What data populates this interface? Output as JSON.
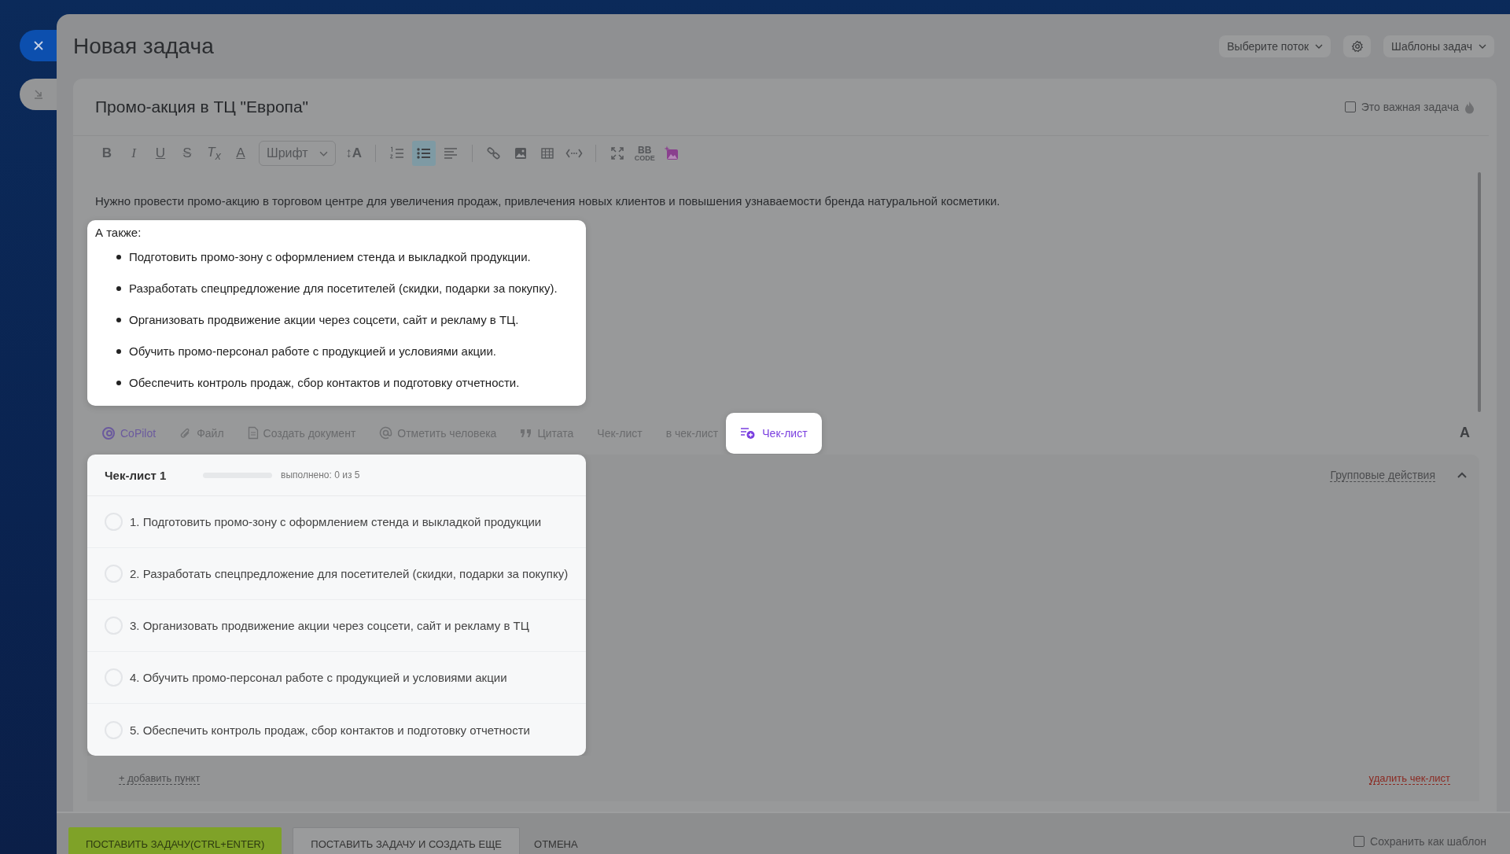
{
  "header": {
    "title": "Новая задача",
    "flow_select": "Выберите поток",
    "templates_select": "Шаблоны задач"
  },
  "task": {
    "title": "Промо-акция в ТЦ \"Европа\"",
    "important": {
      "label": "Это важная задача",
      "checked": false
    }
  },
  "toolbar": {
    "format_buttons": [
      {
        "text": "B"
      },
      {
        "text": "I"
      },
      {
        "text": "U"
      },
      {
        "text": "S"
      },
      {
        "text": "T$_{x}$"
      },
      {
        "text": "A"
      }
    ],
    "font_select": "Шрифт",
    "size_button": "↕A",
    "list_buttons": [
      {
        "selected": false
      },
      {
        "selected": true
      },
      {
        "selected": false
      }
    ],
    "bbcode": {
      "text": "BB",
      "subtext": "CODE"
    }
  },
  "description": {
    "text": "Нужно провести промо-акцию в торговом центре для увеличения продаж, привлечения новых клиентов и повышения узнаваемости бренда натуральной косметики.",
    "list_title": "А также:",
    "list_items": [
      "Подготовить промо-зону с оформлением стенда и выкладкой продукции.",
      "Разработать спецпредложение для посетителей (скидки, подарки за покупку).",
      "Организовать продвижение акции через соцсети, сайт и рекламу в ТЦ.",
      "Обучить промо-персонал работе с продукцией и условиями акции.",
      "Обеспечить контроль продаж, сбор контактов и подготовку отчетности."
    ]
  },
  "attachments": [
    {
      "kind": "copilot",
      "label": "CoPilot"
    },
    {
      "kind": "file",
      "label": "Файл"
    },
    {
      "kind": "document",
      "label": "Создать документ"
    },
    {
      "kind": "mention",
      "label": "Отметить человека"
    },
    {
      "kind": "quote",
      "label": "Цитата"
    },
    {
      "kind": "plain",
      "label": "Чек-лист"
    },
    {
      "kind": "plain",
      "label": "в чек-лист"
    },
    {
      "kind": "checklist",
      "label": "Чек-лист"
    }
  ],
  "text_style_button": "A",
  "checklist": {
    "title": "Чек-лист 1",
    "level": 0,
    "progress": "выполнено: 0 из 5",
    "group_actions": "Групповые действия",
    "expanded": true,
    "items": [
      {
        "text": "1. Подготовить промо-зону с оформлением стенда и выкладкой продукции",
        "checked": false
      },
      {
        "text": "2. Разработать спецпредложение для посетителей (скидки, подарки за покупку)",
        "checked": false
      },
      {
        "text": "3. Организовать продвижение акции через соцсети, сайт и рекламу в ТЦ",
        "checked": false
      },
      {
        "text": "4. Обучить промо-персонал работе с продукцией и условиями акции",
        "checked": false
      },
      {
        "text": "5. Обеспечить контроль продаж, сбор контактов и подготовку отчетности",
        "checked": false
      }
    ],
    "add_item": "+ добавить пункт",
    "delete": "удалить чек-лист"
  },
  "footer": {
    "buttons": [
      {
        "kind": "primary",
        "label": "ПОСТАВИТЬ ЗАДАЧУ(CTRL+ENTER)"
      },
      {
        "kind": "secondary",
        "label": "ПОСТАВИТЬ ЗАДАЧУ И СОЗДАТЬ ЕЩЕ"
      },
      {
        "kind": "link",
        "label": "ОТМЕНА"
      }
    ],
    "save_template": {
      "label": "Сохранить как шаблон",
      "checked": false
    }
  }
}
